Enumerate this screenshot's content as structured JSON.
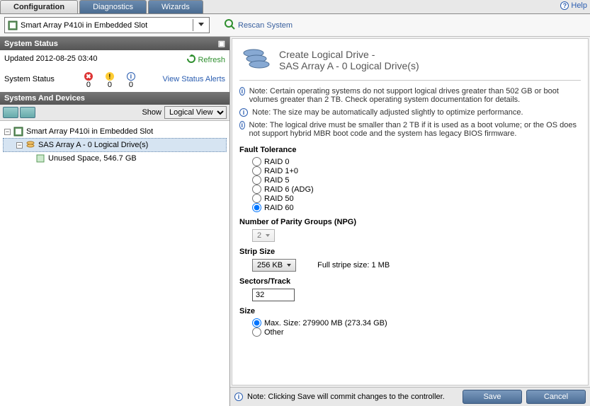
{
  "tabs": {
    "config": "Configuration",
    "diag": "Diagnostics",
    "wiz": "Wizards"
  },
  "help": "Help",
  "device_selector": "Smart Array P410i in Embedded Slot",
  "rescan": "Rescan System",
  "status_panel": {
    "title": "System Status",
    "updated": "Updated 2012-08-25 03:40",
    "refresh": "Refresh",
    "row_label": "System Status",
    "err": "0",
    "warn": "0",
    "info": "0",
    "view_alerts": "View Status Alerts"
  },
  "devices_panel": {
    "title": "Systems And Devices",
    "show_label": "Show",
    "show_value": "Logical View"
  },
  "tree": {
    "root": "Smart Array P410i in Embedded Slot",
    "array": "SAS Array A - 0 Logical Drive(s)",
    "unused": "Unused Space, 546.7 GB"
  },
  "form": {
    "title_main": "Create Logical Drive -",
    "title_sub": "SAS Array A - 0 Logical Drive(s)",
    "note1": "Note: Certain operating systems do not support logical drives greater than 502 GB or boot volumes greater than 2 TB. Check operating system documentation for details.",
    "note2": "Note: The size may be automatically adjusted slightly to optimize performance.",
    "note3": "Note: The logical drive must be smaller than 2 TB if it is used as a boot volume; or the OS does not support hybrid MBR boot code and the system has legacy BIOS firmware.",
    "ft_label": "Fault Tolerance",
    "ft": {
      "r0": "RAID 0",
      "r10": "RAID 1+0",
      "r5": "RAID 5",
      "r6": "RAID 6 (ADG)",
      "r50": "RAID 50",
      "r60": "RAID 60"
    },
    "npg_label": "Number of Parity Groups (NPG)",
    "npg_value": "2",
    "strip_label": "Strip Size",
    "strip_value": "256 KB",
    "strip_full": "Full stripe size: 1 MB",
    "sectors_label": "Sectors/Track",
    "sectors_value": "32",
    "size_label": "Size",
    "size_max": "Max. Size: 279900 MB (273.34 GB)",
    "size_other": "Other"
  },
  "footer": {
    "note": "Note: Clicking Save will commit changes to the controller.",
    "save": "Save",
    "cancel": "Cancel"
  },
  "icons": {
    "toggle": "▣"
  }
}
